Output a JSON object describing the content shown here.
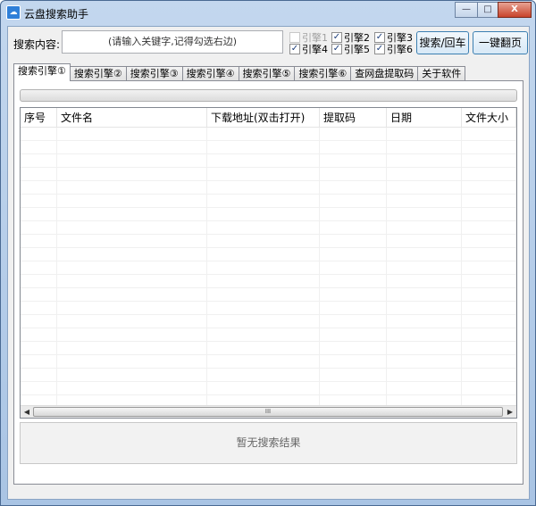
{
  "window": {
    "title": "云盘搜索助手",
    "minimize": "—",
    "maximize": "□",
    "close": "X"
  },
  "search": {
    "label": "搜索内容:",
    "placeholder": "(请输入关键字,记得勾选右边)"
  },
  "engines": [
    {
      "label": "引擎1",
      "checked": false,
      "disabled": true
    },
    {
      "label": "引擎2",
      "checked": true,
      "disabled": false
    },
    {
      "label": "引擎3",
      "checked": true,
      "disabled": false
    },
    {
      "label": "引擎4",
      "checked": true,
      "disabled": false
    },
    {
      "label": "引擎5",
      "checked": true,
      "disabled": false
    },
    {
      "label": "引擎6",
      "checked": true,
      "disabled": false
    }
  ],
  "buttons": {
    "search": "搜索/回车",
    "next_page": "一键翻页"
  },
  "tabs": [
    "搜索引擎①",
    "搜索引擎②",
    "搜索引擎③",
    "搜索引擎④",
    "搜索引擎⑤",
    "搜索引擎⑥",
    "查网盘提取码",
    "关于软件"
  ],
  "table": {
    "columns": [
      "序号",
      "文件名",
      "下载地址(双击打开)",
      "提取码",
      "日期",
      "文件大小"
    ],
    "rows": []
  },
  "scrollbar": {
    "thumb_grip": "III",
    "left_arrow": "◀",
    "right_arrow": "▶"
  },
  "status": "暂无搜索结果"
}
